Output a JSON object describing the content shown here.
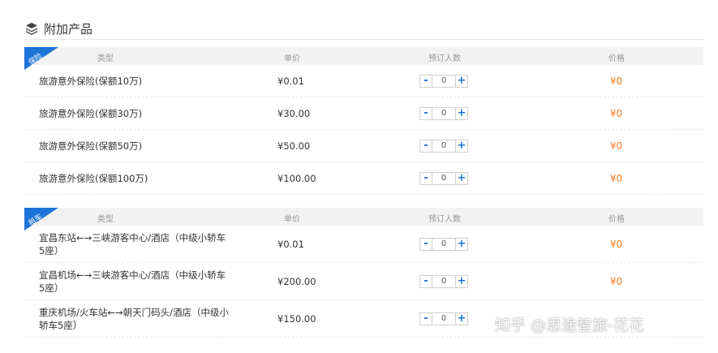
{
  "header": {
    "title": "附加产品",
    "icon": "stack-icon"
  },
  "columns": {
    "type": "类型",
    "price": "单价",
    "count": "预订人数",
    "total": "价格"
  },
  "insurance": {
    "ribbon": "保险",
    "rows": [
      {
        "name": "旅游意外保险(保额10万)",
        "price": "¥0.01",
        "qty": "0",
        "total": "¥0"
      },
      {
        "name": "旅游意外保险(保额30万)",
        "price": "¥30.00",
        "qty": "0",
        "total": "¥0"
      },
      {
        "name": "旅游意外保险(保额50万)",
        "price": "¥50.00",
        "qty": "0",
        "total": "¥0"
      },
      {
        "name": "旅游意外保险(保额100万)",
        "price": "¥100.00",
        "qty": "0",
        "total": "¥0"
      }
    ]
  },
  "car": {
    "ribbon": "租车",
    "rows": [
      {
        "name": "宜昌东站←→三峡游客中心/酒店（中级小轿车5座）",
        "price": "¥0.01",
        "qty": "0",
        "total": "¥0"
      },
      {
        "name": "宜昌机场←→三峡游客中心/酒店（中级小轿车5座）",
        "price": "¥200.00",
        "qty": "0",
        "total": "¥0"
      },
      {
        "name": "重庆机场/火车站←→朝天门码头/酒店（中级小轿车5座）",
        "price": "¥150.00",
        "qty": "0"
      }
    ]
  },
  "stepper": {
    "minus": "-",
    "plus": "+"
  },
  "watermark": "知乎 @思途智旅-花花",
  "colors": {
    "accent": "#1e74d6",
    "price": "#f27c22"
  }
}
